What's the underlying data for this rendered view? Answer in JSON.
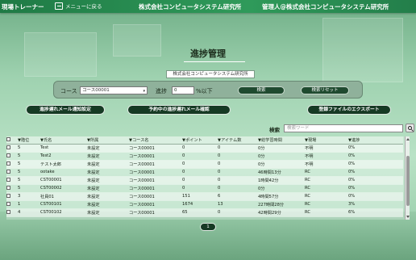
{
  "header": {
    "app_title": "現場トレーナー",
    "back_label": "メニューに戻る",
    "company": "株式会社コンピュータシステム研究所",
    "manager": "管理人@株式会社コンピュータシステム研究所"
  },
  "page": {
    "title": "進捗管理",
    "organization": "株式会社コンピュータシステム研究所"
  },
  "filter": {
    "course_label": "コース",
    "course_value": "コース00001",
    "progress_label": "進捗",
    "progress_value": "0",
    "progress_suffix": "%以下",
    "search_button": "検索",
    "reset_button": "検索リセット"
  },
  "actions": {
    "delay_mail_setting": "進捗遅れメール通知設定",
    "scheduled_delay_mail": "予約中の進捗遅れメール確認",
    "export_files": "登録ファイルのエクスポート"
  },
  "search": {
    "label": "検索",
    "placeholder": "検索ワード"
  },
  "table": {
    "columns": [
      "",
      "▼階位",
      "▼氏名",
      "▼所属",
      "▼コース名",
      "▼ポイント",
      "▼アイテム数",
      "▼総学習時間",
      "▼現場",
      "▼進捗"
    ],
    "rows": [
      [
        "",
        "5",
        "Test",
        "未設定",
        "コース00001",
        "0",
        "0",
        "0分",
        "不明",
        "0%"
      ],
      [
        "",
        "5",
        "Test2",
        "未設定",
        "コース00001",
        "0",
        "0",
        "0分",
        "不明",
        "0%"
      ],
      [
        "",
        "5",
        "テスト太郎",
        "未設定",
        "コース00001",
        "0",
        "0",
        "0分",
        "不明",
        "0%"
      ],
      [
        "",
        "5",
        "ootake",
        "未設定",
        "コース00001",
        "0",
        "0",
        "46時間13分",
        "RC",
        "0%"
      ],
      [
        "",
        "5",
        "CST00001",
        "未設定",
        "コース00001",
        "0",
        "0",
        "1時間42分",
        "RC",
        "0%"
      ],
      [
        "",
        "5",
        "CST00002",
        "未設定",
        "コース00001",
        "0",
        "0",
        "0分",
        "RC",
        "0%"
      ],
      [
        "",
        "3",
        "社員01",
        "未設定",
        "コース00001",
        "151",
        "6",
        "4時間57分",
        "RC",
        "0%"
      ],
      [
        "",
        "1",
        "CST00101",
        "未設定",
        "コース00001",
        "1674",
        "13",
        "227時間28分",
        "RC",
        "3%"
      ],
      [
        "",
        "4",
        "CST00102",
        "未設定",
        "コース00001",
        "65",
        "0",
        "42時間29分",
        "RC",
        "6%"
      ]
    ]
  },
  "pagination": {
    "current_page": "1"
  },
  "colors": {
    "header_bg": "#2f9a5a",
    "button_dark": "#163a24"
  }
}
